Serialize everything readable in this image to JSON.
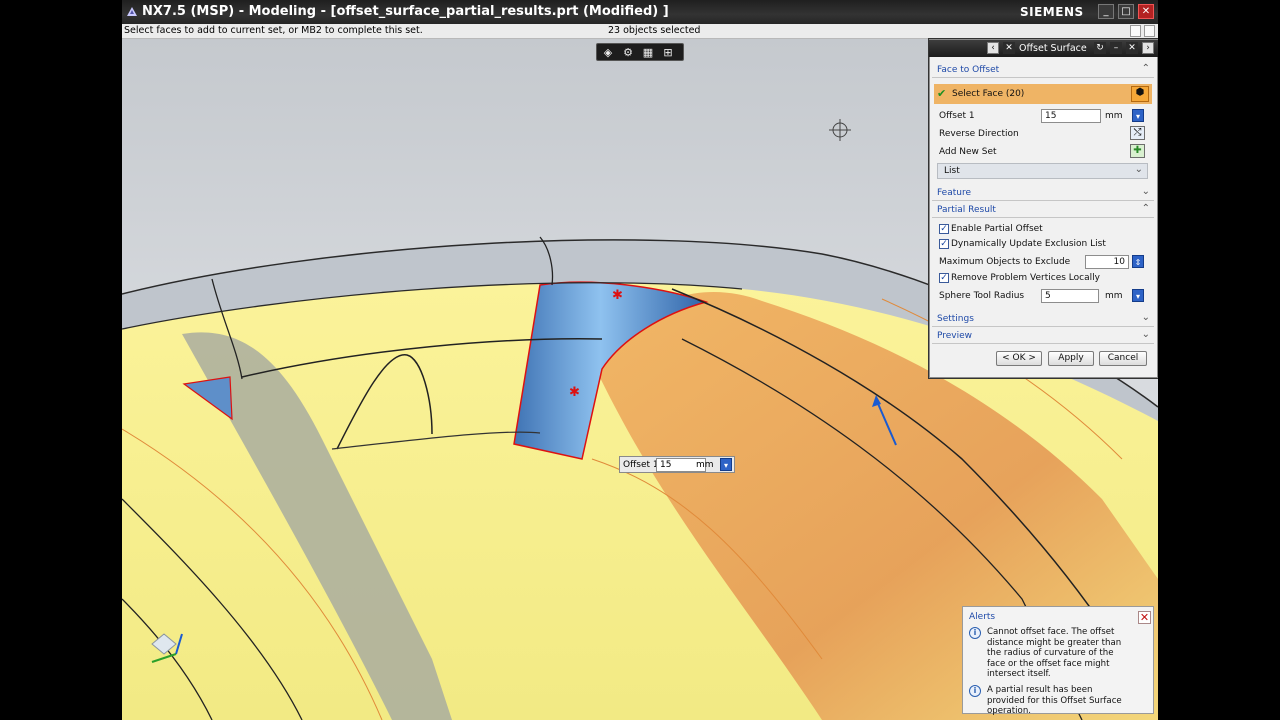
{
  "window": {
    "title": "NX7.5 (MSP) - Modeling - [offset_surface_partial_results.prt (Modified) ]",
    "brand": "SIEMENS"
  },
  "cue": {
    "prompt": "Select faces to add to current set, or MB2 to complete this set.",
    "status": "23 objects selected"
  },
  "dialog": {
    "title": "Offset Surface",
    "face_to_offset": {
      "section_label": "Face to Offset",
      "select_face_label": "Select Face (20)",
      "offset_label": "Offset 1",
      "offset_value": "15",
      "offset_unit": "mm",
      "reverse_direction_label": "Reverse Direction",
      "add_new_set_label": "Add New Set",
      "list_label": "List"
    },
    "feature_label": "Feature",
    "partial_result": {
      "section_label": "Partial Result",
      "enable_partial_offset": "Enable Partial Offset",
      "enable_partial_offset_checked": true,
      "dynamic_update": "Dynamically Update Exclusion List",
      "dynamic_update_checked": true,
      "max_objects_label": "Maximum Objects to Exclude",
      "max_objects_value": "10",
      "remove_problem_vertices": "Remove Problem Vertices Locally",
      "remove_problem_vertices_checked": true,
      "sphere_tool_label": "Sphere Tool Radius",
      "sphere_tool_value": "5",
      "sphere_tool_unit": "mm"
    },
    "settings_label": "Settings",
    "preview_label": "Preview",
    "buttons": {
      "ok": "< OK >",
      "apply": "Apply",
      "cancel": "Cancel"
    }
  },
  "onscreen_input": {
    "label": "Offset 1",
    "value": "15",
    "unit": "mm"
  },
  "alerts": {
    "title": "Alerts",
    "messages": [
      "Cannot offset face. The offset distance might be greater than the radius of curvature of the face or the offset face might intersect itself.",
      "A partial result has been provided for this Offset Surface operation."
    ]
  },
  "colors": {
    "accent_blue": "#2e63c7",
    "surface_yellow": "#f4ec8e",
    "surface_orange": "#e09a58",
    "selected_face_blue": "#5e9ad6"
  }
}
